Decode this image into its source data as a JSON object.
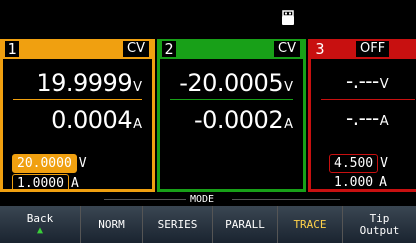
{
  "status": {
    "usb_icon": "usb-drive-icon"
  },
  "channels": [
    {
      "num": "1",
      "mode": "CV",
      "voltage": "19.9999",
      "v_unit": "V",
      "current": "0.0004",
      "a_unit": "A",
      "set_v": "20.0000",
      "set_v_unit": "V",
      "set_a": "1.0000",
      "set_a_unit": "A",
      "color": "#f0a010"
    },
    {
      "num": "2",
      "mode": "CV",
      "voltage": "-20.0005",
      "v_unit": "V",
      "current": "-0.0002",
      "a_unit": "A",
      "color": "#18a018"
    },
    {
      "num": "3",
      "mode": "OFF",
      "voltage": "-.---",
      "v_unit": "V",
      "current": "-.---",
      "a_unit": "A",
      "set_v": "4.500",
      "set_v_unit": "V",
      "set_a": "1.000",
      "set_a_unit": "A",
      "color": "#c81010"
    }
  ],
  "modebar": {
    "label": "MODE",
    "keys": [
      {
        "label": "Back",
        "sub": "▲"
      },
      {
        "label": "NORM"
      },
      {
        "label": "SERIES"
      },
      {
        "label": "PARALL"
      },
      {
        "label": "TRACE",
        "active": true
      },
      {
        "label": "Tip",
        "sub": "Output"
      }
    ]
  }
}
